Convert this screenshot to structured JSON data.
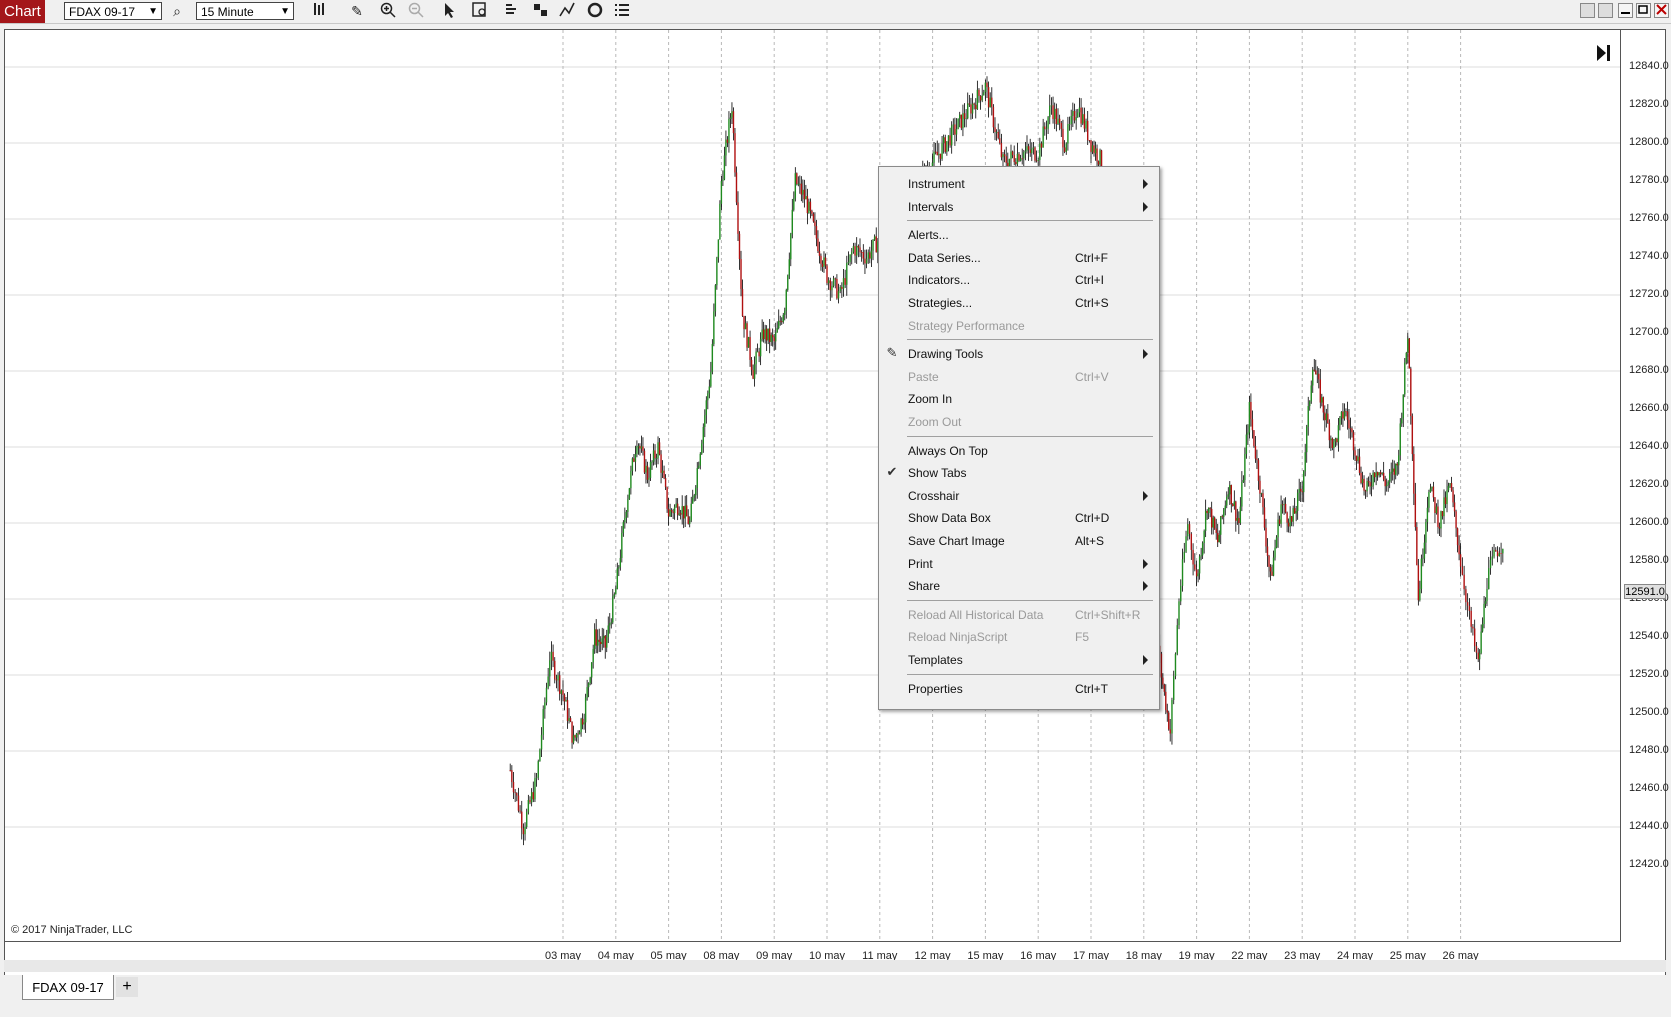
{
  "toolbar": {
    "chart_label": "Chart",
    "instrument_value": "FDAX 09-17",
    "interval_value": "15 Minute",
    "icons": [
      "search-icon",
      "bar-chart-style-icon",
      "pencil-icon",
      "zoom-in-icon",
      "zoom-out-icon",
      "pointer-icon",
      "data-box-icon",
      "indicators-icon",
      "strategies-icon",
      "drawing-tools-icon",
      "properties-icon",
      "list-icon"
    ]
  },
  "chart": {
    "copyright": "© 2017 NinjaTrader, LLC",
    "last_price": "12591.0",
    "price_labels": [
      "12840.0",
      "12820.0",
      "12800.0",
      "12780.0",
      "12760.0",
      "12740.0",
      "12720.0",
      "12700.0",
      "12680.0",
      "12660.0",
      "12640.0",
      "12620.0",
      "12600.0",
      "12580.0",
      "12560.0",
      "12540.0",
      "12520.0",
      "12500.0",
      "12480.0",
      "12460.0",
      "12440.0",
      "12420.0"
    ],
    "date_labels": [
      "03 may",
      "04 may",
      "05 may",
      "08 may",
      "09 may",
      "10 may",
      "11 may",
      "12 may",
      "15 may",
      "16 may",
      "17 may",
      "18 may",
      "19 may",
      "22 may",
      "23 may",
      "24 may",
      "25 may",
      "26 may"
    ],
    "colors": {
      "up": "#1f8a1f",
      "down": "#b01010",
      "wick": "#000000",
      "grid": "#dcdcdc",
      "vgrid": "#b8b8b8"
    }
  },
  "chart_data": {
    "type": "candlestick",
    "title": "",
    "ylim": [
      12410,
      12850
    ],
    "x_categories": [
      "03 may",
      "04 may",
      "05 may",
      "08 may",
      "09 may",
      "10 may",
      "11 may",
      "12 may",
      "15 may",
      "16 may",
      "17 may",
      "18 may",
      "19 may",
      "22 may",
      "23 may",
      "24 may",
      "25 may",
      "26 may"
    ],
    "close_path": [
      {
        "d": "02 may",
        "c": 12470
      },
      {
        "d": "02 may",
        "c": 12440
      },
      {
        "d": "02 may",
        "c": 12465
      },
      {
        "d": "02 may",
        "c": 12530
      },
      {
        "d": "03 may",
        "c": 12510
      },
      {
        "d": "03 may",
        "c": 12485
      },
      {
        "d": "03 may",
        "c": 12500
      },
      {
        "d": "03 may",
        "c": 12540
      },
      {
        "d": "03 may",
        "c": 12535
      },
      {
        "d": "04 may",
        "c": 12565
      },
      {
        "d": "04 may",
        "c": 12610
      },
      {
        "d": "04 may",
        "c": 12645
      },
      {
        "d": "04 may",
        "c": 12625
      },
      {
        "d": "04 may",
        "c": 12640
      },
      {
        "d": "05 may",
        "c": 12605
      },
      {
        "d": "05 may",
        "c": 12610
      },
      {
        "d": "05 may",
        "c": 12600
      },
      {
        "d": "05 may",
        "c": 12640
      },
      {
        "d": "05 may",
        "c": 12680
      },
      {
        "d": "08 may",
        "c": 12780
      },
      {
        "d": "08 may",
        "c": 12820
      },
      {
        "d": "08 may",
        "c": 12710
      },
      {
        "d": "08 may",
        "c": 12680
      },
      {
        "d": "08 may",
        "c": 12700
      },
      {
        "d": "09 may",
        "c": 12695
      },
      {
        "d": "09 may",
        "c": 12715
      },
      {
        "d": "09 may",
        "c": 12780
      },
      {
        "d": "09 may",
        "c": 12770
      },
      {
        "d": "09 may",
        "c": 12750
      },
      {
        "d": "10 may",
        "c": 12730
      },
      {
        "d": "10 may",
        "c": 12720
      },
      {
        "d": "10 may",
        "c": 12745
      },
      {
        "d": "10 may",
        "c": 12740
      },
      {
        "d": "15 may",
        "c": 12830
      },
      {
        "d": "15 may",
        "c": 12790
      },
      {
        "d": "15 may",
        "c": 12795
      },
      {
        "d": "16 may",
        "c": 12795
      },
      {
        "d": "16 may",
        "c": 12820
      },
      {
        "d": "16 may",
        "c": 12800
      },
      {
        "d": "16 may",
        "c": 12820
      },
      {
        "d": "17 may",
        "c": 12800
      },
      {
        "d": "17 may",
        "c": 12790
      },
      {
        "d": "17 may",
        "c": 12760
      },
      {
        "d": "17 may",
        "c": 12690
      },
      {
        "d": "17 may",
        "c": 12640
      },
      {
        "d": "18 may",
        "c": 12600
      },
      {
        "d": "18 may",
        "c": 12560
      },
      {
        "d": "18 may",
        "c": 12520
      },
      {
        "d": "18 may",
        "c": 12490
      },
      {
        "d": "18 may",
        "c": 12560
      },
      {
        "d": "18 may",
        "c": 12600
      },
      {
        "d": "19 may",
        "c": 12570
      },
      {
        "d": "19 may",
        "c": 12610
      },
      {
        "d": "19 may",
        "c": 12590
      },
      {
        "d": "19 may",
        "c": 12620
      },
      {
        "d": "19 may",
        "c": 12600
      },
      {
        "d": "22 may",
        "c": 12660
      },
      {
        "d": "22 may",
        "c": 12620
      },
      {
        "d": "22 may",
        "c": 12570
      },
      {
        "d": "22 may",
        "c": 12610
      },
      {
        "d": "22 may",
        "c": 12600
      },
      {
        "d": "23 may",
        "c": 12620
      },
      {
        "d": "23 may",
        "c": 12685
      },
      {
        "d": "23 may",
        "c": 12660
      },
      {
        "d": "23 may",
        "c": 12640
      },
      {
        "d": "23 may",
        "c": 12660
      },
      {
        "d": "24 may",
        "c": 12640
      },
      {
        "d": "24 may",
        "c": 12615
      },
      {
        "d": "24 may",
        "c": 12630
      },
      {
        "d": "24 may",
        "c": 12620
      },
      {
        "d": "24 may",
        "c": 12630
      },
      {
        "d": "25 may",
        "c": 12700
      },
      {
        "d": "25 may",
        "c": 12560
      },
      {
        "d": "25 may",
        "c": 12620
      },
      {
        "d": "25 may",
        "c": 12600
      },
      {
        "d": "25 may",
        "c": 12620
      },
      {
        "d": "26 may",
        "c": 12580
      },
      {
        "d": "26 may",
        "c": 12550
      },
      {
        "d": "26 may",
        "c": 12525
      },
      {
        "d": "26 may",
        "c": 12570
      },
      {
        "d": "26 may",
        "c": 12585
      },
      {
        "d": "26 may",
        "c": 12591
      }
    ]
  },
  "menu": {
    "items": [
      {
        "label": "Instrument",
        "shortcut": "",
        "submenu": true,
        "disabled": false,
        "icon": "",
        "sep_after": false
      },
      {
        "label": "Intervals",
        "shortcut": "",
        "submenu": true,
        "disabled": false,
        "icon": "",
        "sep_after": true
      },
      {
        "label": "Alerts...",
        "shortcut": "",
        "submenu": false,
        "disabled": false,
        "icon": "",
        "sep_after": false
      },
      {
        "label": "Data Series...",
        "shortcut": "Ctrl+F",
        "submenu": false,
        "disabled": false,
        "icon": "",
        "sep_after": false
      },
      {
        "label": "Indicators...",
        "shortcut": "Ctrl+I",
        "submenu": false,
        "disabled": false,
        "icon": "",
        "sep_after": false
      },
      {
        "label": "Strategies...",
        "shortcut": "Ctrl+S",
        "submenu": false,
        "disabled": false,
        "icon": "",
        "sep_after": false
      },
      {
        "label": "Strategy Performance",
        "shortcut": "",
        "submenu": false,
        "disabled": true,
        "icon": "",
        "sep_after": true
      },
      {
        "label": "Drawing Tools",
        "shortcut": "",
        "submenu": true,
        "disabled": false,
        "icon": "pencil-icon",
        "sep_after": false
      },
      {
        "label": "Paste",
        "shortcut": "Ctrl+V",
        "submenu": false,
        "disabled": true,
        "icon": "",
        "sep_after": false
      },
      {
        "label": "Zoom In",
        "shortcut": "",
        "submenu": false,
        "disabled": false,
        "icon": "",
        "sep_after": false
      },
      {
        "label": "Zoom Out",
        "shortcut": "",
        "submenu": false,
        "disabled": true,
        "icon": "",
        "sep_after": true
      },
      {
        "label": "Always On Top",
        "shortcut": "",
        "submenu": false,
        "disabled": false,
        "icon": "",
        "sep_after": false
      },
      {
        "label": "Show Tabs",
        "shortcut": "",
        "submenu": false,
        "disabled": false,
        "icon": "check-icon",
        "sep_after": false
      },
      {
        "label": "Crosshair",
        "shortcut": "",
        "submenu": true,
        "disabled": false,
        "icon": "",
        "sep_after": false
      },
      {
        "label": "Show Data Box",
        "shortcut": "Ctrl+D",
        "submenu": false,
        "disabled": false,
        "icon": "",
        "sep_after": false
      },
      {
        "label": "Save Chart Image",
        "shortcut": "Alt+S",
        "submenu": false,
        "disabled": false,
        "icon": "",
        "sep_after": false
      },
      {
        "label": "Print",
        "shortcut": "",
        "submenu": true,
        "disabled": false,
        "icon": "",
        "sep_after": false
      },
      {
        "label": "Share",
        "shortcut": "",
        "submenu": true,
        "disabled": false,
        "icon": "",
        "sep_after": true
      },
      {
        "label": "Reload All Historical Data",
        "shortcut": "Ctrl+Shift+R",
        "submenu": false,
        "disabled": true,
        "icon": "",
        "sep_after": false
      },
      {
        "label": "Reload NinjaScript",
        "shortcut": "F5",
        "submenu": false,
        "disabled": true,
        "icon": "",
        "sep_after": false
      },
      {
        "label": "Templates",
        "shortcut": "",
        "submenu": true,
        "disabled": false,
        "icon": "",
        "sep_after": true
      },
      {
        "label": "Properties",
        "shortcut": "Ctrl+T",
        "submenu": false,
        "disabled": false,
        "icon": "",
        "sep_after": false
      }
    ]
  },
  "tabs": {
    "active_label": "FDAX 09-17",
    "add_label": "+"
  }
}
